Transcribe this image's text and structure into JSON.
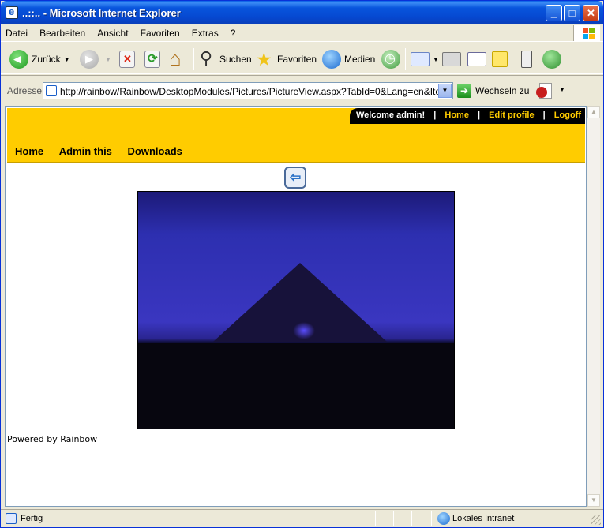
{
  "window": {
    "title": "..::.. - Microsoft Internet Explorer",
    "min_glyph": "_",
    "max_glyph": "□",
    "close_glyph": "✕"
  },
  "menu": {
    "items": [
      "Datei",
      "Bearbeiten",
      "Ansicht",
      "Favoriten",
      "Extras",
      "?"
    ]
  },
  "toolbar": {
    "back_label": "Zurück",
    "search_label": "Suchen",
    "favorites_label": "Favoriten",
    "media_label": "Medien"
  },
  "address": {
    "label": "Adresse",
    "url": "http://rainbow/Rainbow/DesktopModules/Pictures/PictureView.aspx?TabId=0&Lang=en&ItemID=2&",
    "go_label": "Wechseln zu"
  },
  "page": {
    "welcome": "Welcome admin!",
    "header_links": [
      "Home",
      "Edit profile",
      "Logoff"
    ],
    "nav": [
      "Home",
      "Admin this",
      "Downloads"
    ],
    "footer": "Powered by Rainbow"
  },
  "status": {
    "text": "Fertig",
    "zone": "Lokales Intranet"
  },
  "colors": {
    "header_yellow": "#ffcc00",
    "welcome_bar": "#000000",
    "xp_blue": "#0a5fe6"
  }
}
